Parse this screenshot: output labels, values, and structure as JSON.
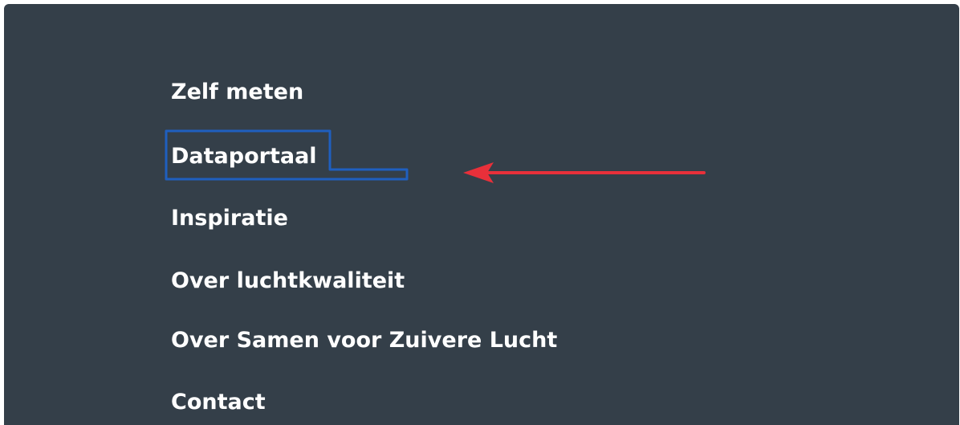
{
  "menu": {
    "items": [
      {
        "label": "Zelf meten"
      },
      {
        "label": "Dataportaal",
        "focused": true
      },
      {
        "label": "Inspiratie"
      },
      {
        "label": "Over luchtkwaliteit"
      },
      {
        "label": "Over Samen voor Zuivere Lucht"
      },
      {
        "label": "Contact"
      }
    ]
  },
  "colors": {
    "background": "#343f49",
    "text": "#ffffff",
    "focus_outline": "#1f5fbf",
    "annotation_arrow": "#e8303a"
  },
  "annotation": {
    "icon": "arrow-left-icon"
  }
}
